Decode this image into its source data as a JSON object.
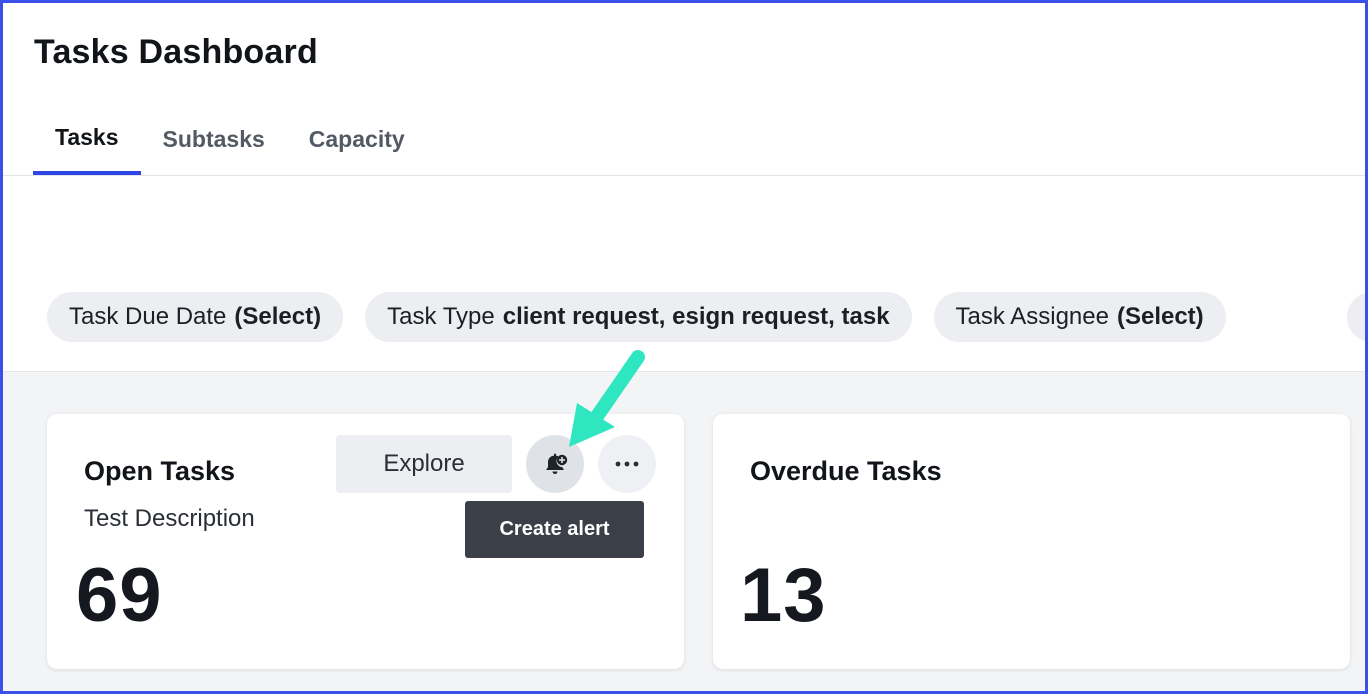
{
  "page": {
    "title": "Tasks Dashboard"
  },
  "tabs": [
    {
      "label": "Tasks",
      "active": true
    },
    {
      "label": "Subtasks",
      "active": false
    },
    {
      "label": "Capacity",
      "active": false
    }
  ],
  "filters": [
    {
      "name": "Task Due Date",
      "value": "(Select)"
    },
    {
      "name": "Task Type",
      "value": "client request, esign request, task"
    },
    {
      "name": "Task Assignee",
      "value": "(Select)"
    }
  ],
  "cards": [
    {
      "title": "Open Tasks",
      "description": "Test Description",
      "value": "69",
      "explore_label": "Explore",
      "alert_icon": "bell-plus-icon",
      "more_icon": "more-horizontal-icon",
      "tooltip": "Create alert"
    },
    {
      "title": "Overdue Tasks",
      "value": "13"
    }
  ],
  "colors": {
    "accent": "#2f46e6",
    "frame_border": "#3b50e8",
    "annotation_arrow": "#2ee6c0",
    "tooltip_bg": "#3a3f48"
  }
}
